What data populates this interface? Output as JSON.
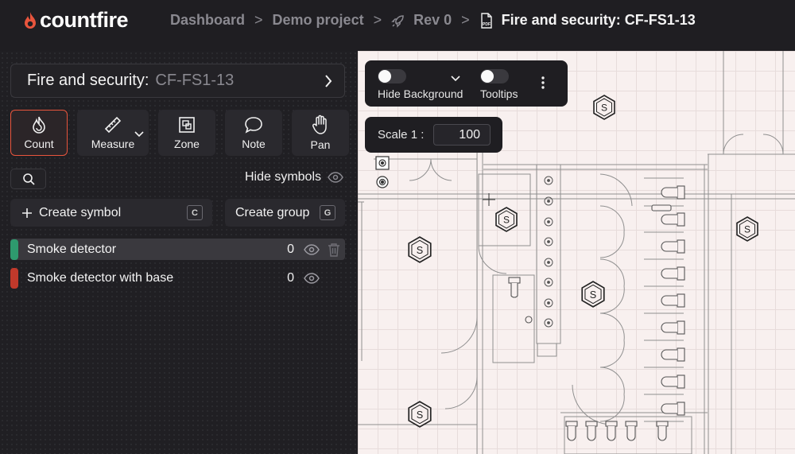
{
  "app": {
    "brand": "countfire",
    "brand_color": "#e8553d"
  },
  "breadcrumb": {
    "items": [
      "Dashboard",
      "Demo project",
      "Rev 0",
      "Fire and security: CF-FS1-13"
    ],
    "separator": ">"
  },
  "document": {
    "title": "Fire and security:",
    "code": "CF-FS1-13"
  },
  "tools": [
    {
      "label": "Count",
      "icon": "flame-icon",
      "active": true
    },
    {
      "label": "Measure",
      "icon": "ruler-icon",
      "has_dropdown": true
    },
    {
      "label": "Zone",
      "icon": "zone-icon"
    },
    {
      "label": "Note",
      "icon": "chat-bubble-icon"
    },
    {
      "label": "Pan",
      "icon": "hand-icon"
    }
  ],
  "symbols_bar": {
    "hide_label": "Hide symbols"
  },
  "actions": {
    "create_symbol": {
      "label": "Create symbol",
      "shortcut": "C"
    },
    "create_group": {
      "label": "Create group",
      "shortcut": "G"
    }
  },
  "symbols": [
    {
      "name": "Smoke detector",
      "count": "0",
      "color": "#2e9a6e",
      "highlighted": true
    },
    {
      "name": "Smoke detector with base",
      "count": "0",
      "color": "#c0392b",
      "highlighted": false
    }
  ],
  "viewer": {
    "hide_background_label": "Hide Background",
    "tooltips_label": "Tooltips",
    "scale_label": "Scale 1 :",
    "scale_value": "100",
    "symbol_marker_letter": "S"
  }
}
